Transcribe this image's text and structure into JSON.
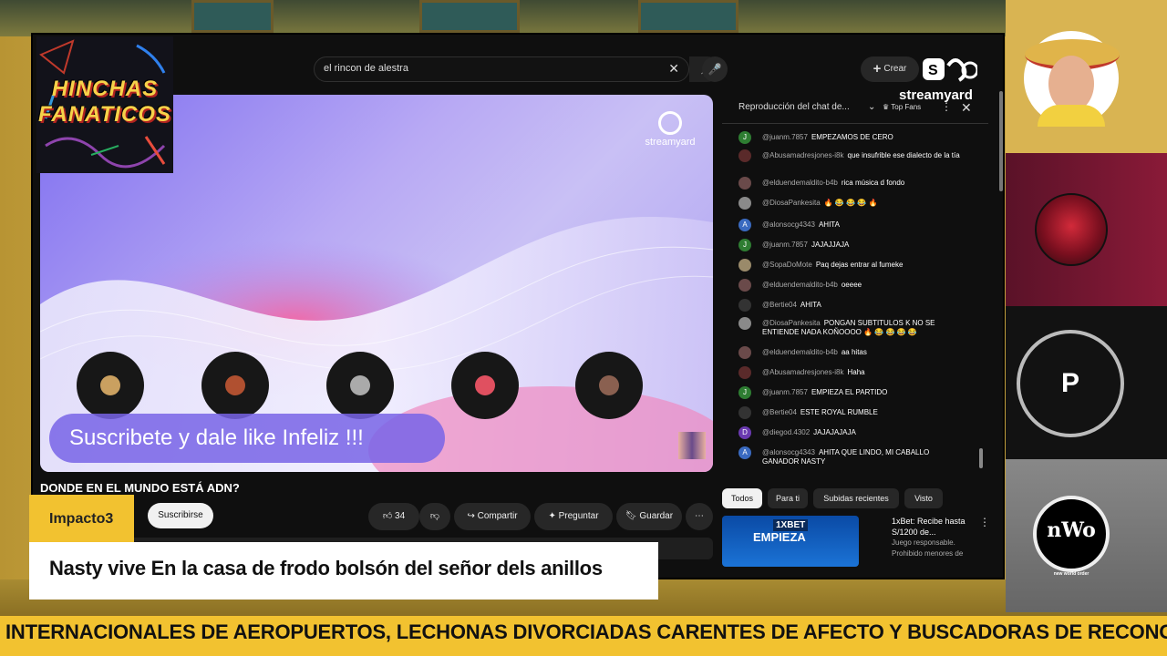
{
  "youtube": {
    "search_value": "el rincon de alestra",
    "create_label": "Crear",
    "streamyard_label": "streamyard",
    "video": {
      "watermark": "streamyard",
      "overlay_text": "Suscribete y dale like Infeliz !!!",
      "title": "DONDE EN EL MUNDO ESTÁ ADN?"
    },
    "subscribe_label": "Suscribirse",
    "actions": {
      "likes": "34",
      "share": "Compartir",
      "ask": "Preguntar",
      "save": "Guardar"
    },
    "chat": {
      "header": "Reproducción del chat de...",
      "top_fans": "Top Fans",
      "messages": [
        {
          "author": "@juanm.7857",
          "text": "EMPEZAMOS DE CERO",
          "initial": "J",
          "color": "#2e7d32"
        },
        {
          "author": "@Abusamadresjones-i8k",
          "text": "que insufrible ese dialecto de la tía",
          "initial": "",
          "color": "#5a2a2a"
        },
        {
          "author": "@elduendemaldito-b4b",
          "text": "rica música d fondo",
          "initial": "",
          "color": "#6a4a4a"
        },
        {
          "author": "@DiosaPankesita",
          "text": "🔥 😂 😂 😂 🔥",
          "initial": "",
          "color": "#8a8a8a"
        },
        {
          "author": "@alonsocg4343",
          "text": "AHITA",
          "initial": "A",
          "color": "#3a6ac0"
        },
        {
          "author": "@juanm.7857",
          "text": "JAJAJJAJA",
          "initial": "J",
          "color": "#2e7d32"
        },
        {
          "author": "@SopaDoMote",
          "text": "Paq dejas entrar al fumeke",
          "initial": "",
          "color": "#9a8a6a"
        },
        {
          "author": "@elduendemaldito-b4b",
          "text": "oeeee",
          "initial": "",
          "color": "#6a4a4a"
        },
        {
          "author": "@Bertie04",
          "text": "AHITA",
          "initial": "",
          "color": "#333333"
        },
        {
          "author": "@DiosaPankesita",
          "text": "PONGAN SUBTITULOS K NO SE ENTIENDE NADA KOÑOOOO 🔥 😂 😂 😂 😂",
          "initial": "",
          "color": "#8a8a8a"
        },
        {
          "author": "@elduendemaldito-b4b",
          "text": "aa hitas",
          "initial": "",
          "color": "#6a4a4a"
        },
        {
          "author": "@Abusamadresjones-i8k",
          "text": "Haha",
          "initial": "",
          "color": "#5a2a2a"
        },
        {
          "author": "@juanm.7857",
          "text": "EMPIEZA EL PARTIDO",
          "initial": "J",
          "color": "#2e7d32"
        },
        {
          "author": "@Bertie04",
          "text": "ESTE ROYAL RUMBLE",
          "initial": "",
          "color": "#333333"
        },
        {
          "author": "@diegod.4302",
          "text": "JAJAJAJAJA",
          "initial": "D",
          "color": "#6a3ab0"
        },
        {
          "author": "@alonsocg4343",
          "text": "AHITA QUE LINDO, MI CABALLO GANADOR NASTY",
          "initial": "A",
          "color": "#3a6ac0"
        }
      ]
    },
    "chips": [
      "Todos",
      "Para ti",
      "Subidas recientes",
      "Visto"
    ],
    "ad": {
      "brand": "1XBET",
      "image_text": "EMPIEZA",
      "title": "1xBet: Recibe hasta S/1200 de...",
      "sub1": "Juego responsable.",
      "sub2": "Prohibido menores de"
    }
  },
  "logo": {
    "line1": "HINCHAS",
    "line2": "FANATICOS"
  },
  "tag": "Impacto3",
  "lower_third": "Nasty vive En la casa de frodo bolsón del señor dels anillos",
  "ticker": "INTERNACIONALES DE AEROPUERTOS, LECHONAS DIVORCIADAS CARENTES DE AFECTO Y BUSCADORAS DE RECONOCIMIE",
  "guests": {
    "p_label": "P",
    "nwo_text": "nWo",
    "nwo_sub": "new world order"
  }
}
